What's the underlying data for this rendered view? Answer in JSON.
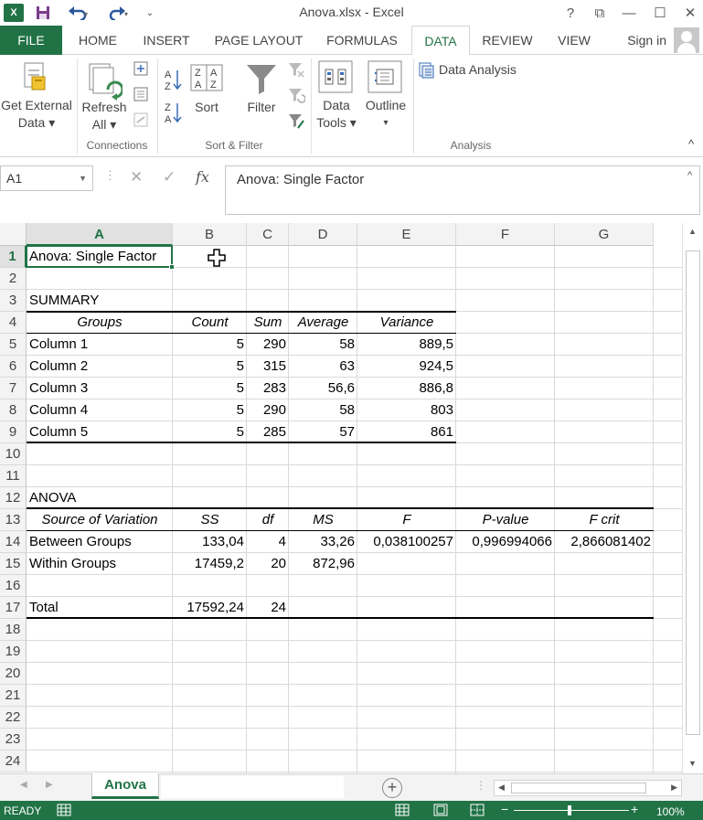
{
  "window": {
    "title": "Anova.xlsx - Excel",
    "help": "?",
    "restore": "⧉",
    "minimize": "—",
    "maximize": "☐",
    "close": "✕"
  },
  "tabs": [
    "FILE",
    "HOME",
    "INSERT",
    "PAGE LAYOUT",
    "FORMULAS",
    "DATA",
    "REVIEW",
    "VIEW"
  ],
  "active_tab": "DATA",
  "signin": "Sign in",
  "ribbon": {
    "get_external_line1": "Get External",
    "get_external_line2": "Data ▾",
    "refresh_line1": "Refresh",
    "refresh_line2": "All ▾",
    "connections_label": "Connections",
    "sort_label": "Sort",
    "filter_label": "Filter",
    "sort_filter_label": "Sort & Filter",
    "data_tools_line1": "Data",
    "data_tools_line2": "Tools ▾",
    "outline_label": "Outline",
    "outline_arrow": "▾",
    "data_analysis_label": "Data Analysis",
    "analysis_label": "Analysis",
    "collapse": "^"
  },
  "formula_bar": {
    "name_box": "A1",
    "fx": "fx",
    "cancel": "✕",
    "enter": "✓",
    "content": "Anova: Single Factor"
  },
  "grid": {
    "columns": [
      "A",
      "B",
      "C",
      "D",
      "E",
      "F",
      "G"
    ],
    "rows": [
      "1",
      "2",
      "3",
      "4",
      "5",
      "6",
      "7",
      "8",
      "9",
      "10",
      "11",
      "12",
      "13",
      "14",
      "15",
      "16",
      "17",
      "18",
      "19",
      "20",
      "21",
      "22",
      "23",
      "24"
    ],
    "selected_cell": "A1"
  },
  "cells": {
    "a1": "Anova: Single Factor",
    "a3": "SUMMARY",
    "summary_headers": [
      "Groups",
      "Count",
      "Sum",
      "Average",
      "Variance"
    ],
    "summary_rows": [
      [
        "Column 1",
        "5",
        "290",
        "58",
        "889,5"
      ],
      [
        "Column 2",
        "5",
        "315",
        "63",
        "924,5"
      ],
      [
        "Column 3",
        "5",
        "283",
        "56,6",
        "886,8"
      ],
      [
        "Column 4",
        "5",
        "290",
        "58",
        "803"
      ],
      [
        "Column 5",
        "5",
        "285",
        "57",
        "861"
      ]
    ],
    "a12": "ANOVA",
    "anova_headers": [
      "Source of Variation",
      "SS",
      "df",
      "MS",
      "F",
      "P-value",
      "F crit"
    ],
    "anova_rows": [
      [
        "Between Groups",
        "133,04",
        "4",
        "33,26",
        "0,038100257",
        "0,996994066",
        "2,866081402"
      ],
      [
        "Within Groups",
        "17459,2",
        "20",
        "872,96",
        "",
        "",
        ""
      ]
    ],
    "total_row": [
      "Total",
      "17592,24",
      "24"
    ]
  },
  "sheet_tabs": [
    "Anova"
  ],
  "status": {
    "ready": "READY",
    "zoom": "100%"
  },
  "colors": {
    "excel_green": "#217346",
    "header_bg": "#f3f3f3",
    "gridline": "#d9d9d9"
  }
}
